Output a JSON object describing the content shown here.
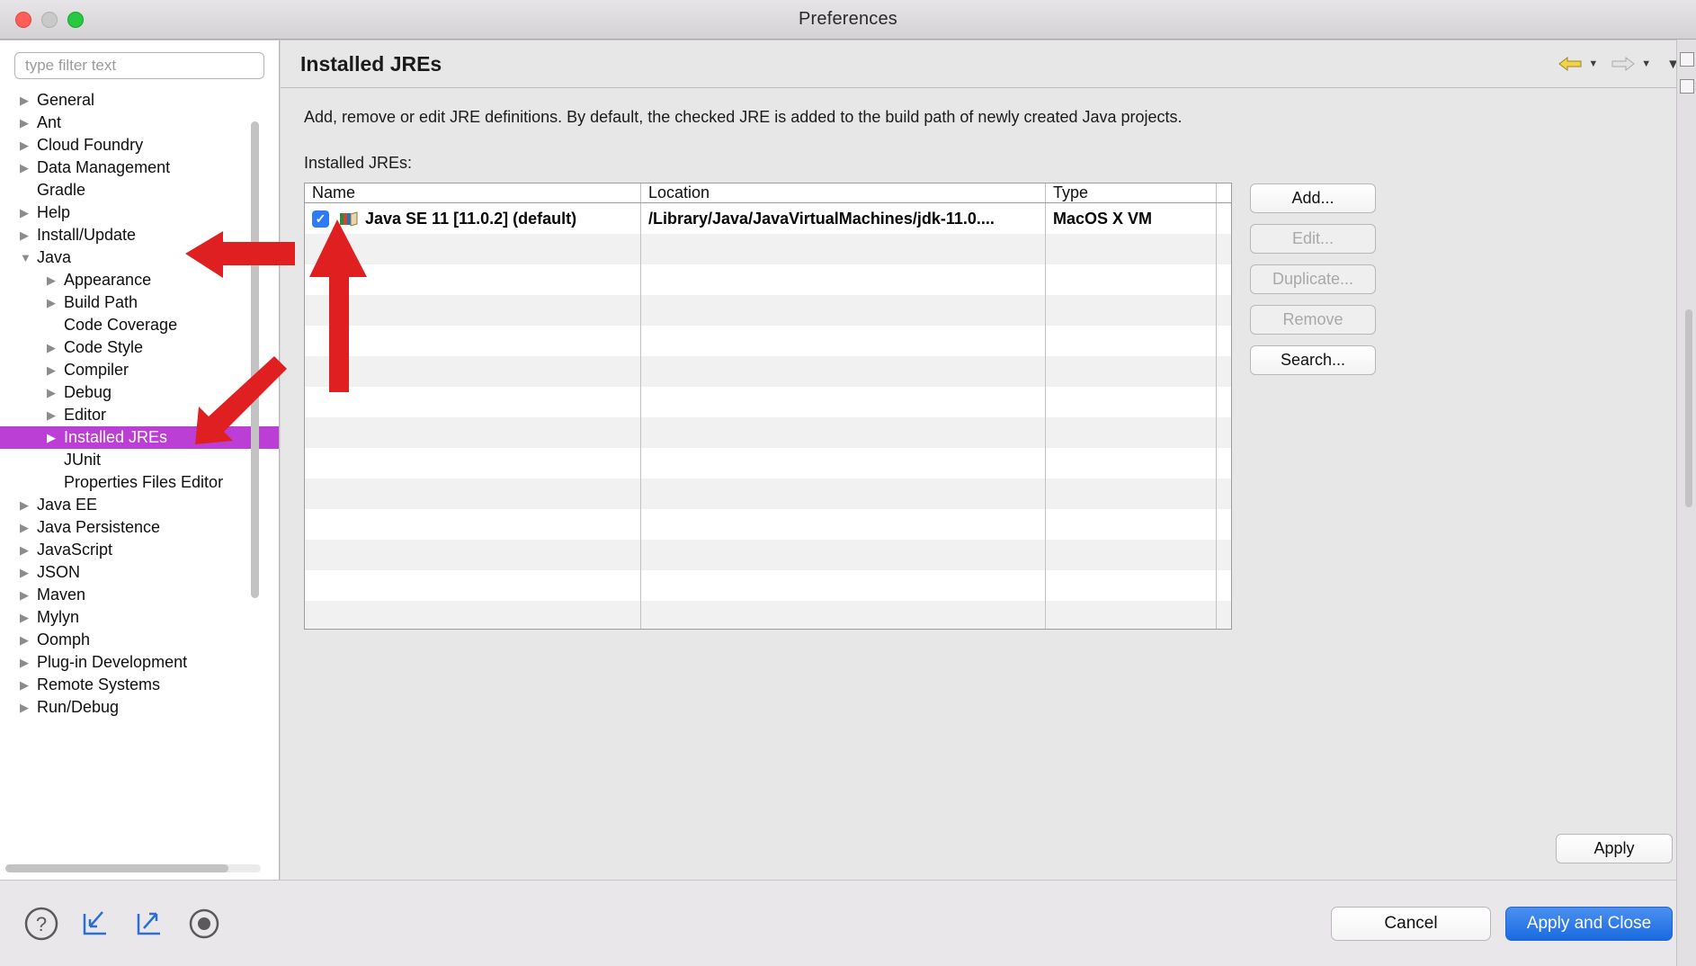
{
  "window": {
    "title": "Preferences",
    "traffic_lights": [
      "close-button",
      "minimize-button",
      "maximize-button"
    ]
  },
  "sidebar": {
    "filter": {
      "value": "",
      "placeholder": "type filter text"
    },
    "items": [
      {
        "label": "General",
        "level": 1,
        "expandable": true,
        "expanded": false,
        "selected": false
      },
      {
        "label": "Ant",
        "level": 1,
        "expandable": true,
        "expanded": false,
        "selected": false
      },
      {
        "label": "Cloud Foundry",
        "level": 1,
        "expandable": true,
        "expanded": false,
        "selected": false
      },
      {
        "label": "Data Management",
        "level": 1,
        "expandable": true,
        "expanded": false,
        "selected": false
      },
      {
        "label": "Gradle",
        "level": 1,
        "expandable": false,
        "expanded": false,
        "selected": false
      },
      {
        "label": "Help",
        "level": 1,
        "expandable": true,
        "expanded": false,
        "selected": false
      },
      {
        "label": "Install/Update",
        "level": 1,
        "expandable": true,
        "expanded": false,
        "selected": false
      },
      {
        "label": "Java",
        "level": 1,
        "expandable": true,
        "expanded": true,
        "selected": false
      },
      {
        "label": "Appearance",
        "level": 2,
        "expandable": true,
        "expanded": false,
        "selected": false
      },
      {
        "label": "Build Path",
        "level": 2,
        "expandable": true,
        "expanded": false,
        "selected": false
      },
      {
        "label": "Code Coverage",
        "level": 2,
        "expandable": false,
        "expanded": false,
        "selected": false
      },
      {
        "label": "Code Style",
        "level": 2,
        "expandable": true,
        "expanded": false,
        "selected": false
      },
      {
        "label": "Compiler",
        "level": 2,
        "expandable": true,
        "expanded": false,
        "selected": false
      },
      {
        "label": "Debug",
        "level": 2,
        "expandable": true,
        "expanded": false,
        "selected": false
      },
      {
        "label": "Editor",
        "level": 2,
        "expandable": true,
        "expanded": false,
        "selected": false
      },
      {
        "label": "Installed JREs",
        "level": 2,
        "expandable": true,
        "expanded": false,
        "selected": true
      },
      {
        "label": "JUnit",
        "level": 2,
        "expandable": false,
        "expanded": false,
        "selected": false
      },
      {
        "label": "Properties Files Editor",
        "level": 2,
        "expandable": false,
        "expanded": false,
        "selected": false
      },
      {
        "label": "Java EE",
        "level": 1,
        "expandable": true,
        "expanded": false,
        "selected": false
      },
      {
        "label": "Java Persistence",
        "level": 1,
        "expandable": true,
        "expanded": false,
        "selected": false
      },
      {
        "label": "JavaScript",
        "level": 1,
        "expandable": true,
        "expanded": false,
        "selected": false
      },
      {
        "label": "JSON",
        "level": 1,
        "expandable": true,
        "expanded": false,
        "selected": false
      },
      {
        "label": "Maven",
        "level": 1,
        "expandable": true,
        "expanded": false,
        "selected": false
      },
      {
        "label": "Mylyn",
        "level": 1,
        "expandable": true,
        "expanded": false,
        "selected": false
      },
      {
        "label": "Oomph",
        "level": 1,
        "expandable": true,
        "expanded": false,
        "selected": false
      },
      {
        "label": "Plug-in Development",
        "level": 1,
        "expandable": true,
        "expanded": false,
        "selected": false
      },
      {
        "label": "Remote Systems",
        "level": 1,
        "expandable": true,
        "expanded": false,
        "selected": false
      },
      {
        "label": "Run/Debug",
        "level": 1,
        "expandable": true,
        "expanded": false,
        "selected": false
      }
    ],
    "selection_color": "#bb3fd4"
  },
  "pane": {
    "title": "Installed JREs",
    "nav": {
      "back_icon": "back-arrow-icon",
      "forward_icon": "forward-arrow-icon",
      "menu_icon": "chevron-down-icon"
    },
    "description": "Add, remove or edit JRE definitions. By default, the checked JRE is added to the build path of newly created Java projects.",
    "list_label": "Installed JREs:",
    "table": {
      "columns": [
        "Name",
        "Location",
        "Type",
        ""
      ],
      "rows": [
        {
          "checked": true,
          "icon": "jre-icon",
          "name": "Java SE 11 [11.0.2] (default)",
          "location": "/Library/Java/JavaVirtualMachines/jdk-11.0....",
          "type": "MacOS X VM"
        }
      ],
      "empty_row_count": 13
    },
    "buttons": [
      {
        "label": "Add...",
        "enabled": true
      },
      {
        "label": "Edit...",
        "enabled": false
      },
      {
        "label": "Duplicate...",
        "enabled": false
      },
      {
        "label": "Remove",
        "enabled": false
      },
      {
        "label": "Search...",
        "enabled": true
      }
    ],
    "apply_label": "Apply"
  },
  "footer": {
    "icons": [
      "help-icon",
      "import-icon",
      "export-icon",
      "record-icon"
    ],
    "cancel_label": "Cancel",
    "apply_close_label": "Apply and Close",
    "primary_color": "#1a6ae0"
  },
  "annotations": {
    "arrow_color": "#e02020",
    "arrow_java_target": "Java",
    "arrow_installed_jres_target": "Installed JREs",
    "arrow_checkbox_target": "jre-row-checkbox"
  }
}
